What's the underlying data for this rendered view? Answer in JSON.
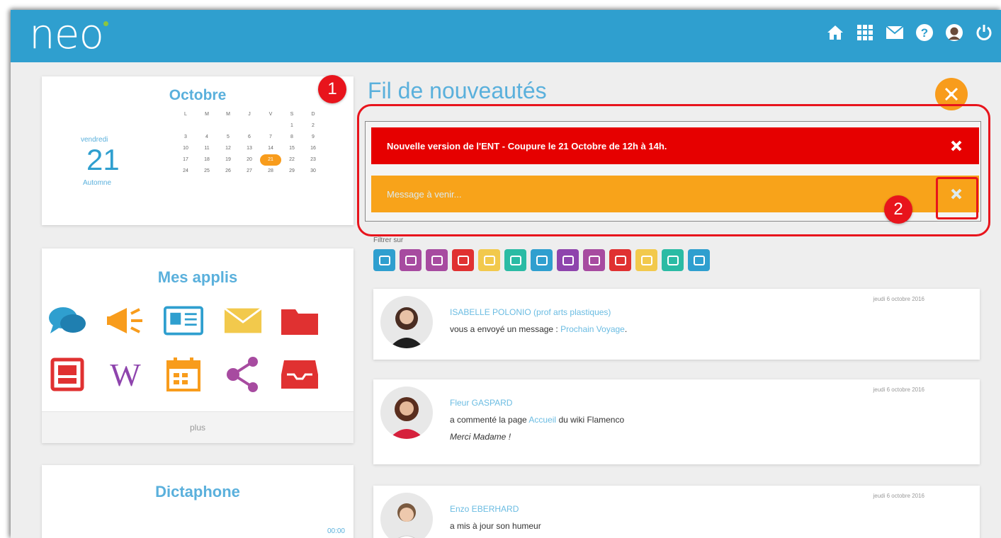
{
  "header": {
    "logo": "neo",
    "icons": [
      "home-icon",
      "apps-grid-icon",
      "mail-icon",
      "help-icon",
      "avatar",
      "power-icon"
    ]
  },
  "calendar": {
    "month": "Octobre",
    "day_name": "vendredi",
    "day_number": "21",
    "season": "Automne",
    "weekdays": [
      "L",
      "M",
      "M",
      "J",
      "V",
      "S",
      "D"
    ],
    "weeks": [
      [
        "",
        "",
        "",
        "",
        "",
        "1",
        "2"
      ],
      [
        "3",
        "4",
        "5",
        "6",
        "7",
        "8",
        "9"
      ],
      [
        "10",
        "11",
        "12",
        "13",
        "14",
        "15",
        "16"
      ],
      [
        "17",
        "18",
        "19",
        "20",
        "21",
        "22",
        "23"
      ],
      [
        "24",
        "25",
        "26",
        "27",
        "28",
        "29",
        "30"
      ]
    ],
    "today": "21"
  },
  "apps": {
    "title": "Mes applis",
    "items": [
      "messagerie-icon",
      "actualites-icon",
      "annuaire-icon",
      "mail-icon",
      "documents-icon",
      "tableau-icon",
      "wiki-icon",
      "calendrier-icon",
      "reseau-icon",
      "casier-icon"
    ],
    "more_label": "plus"
  },
  "dictaphone": {
    "title": "Dictaphone",
    "time": "00:00"
  },
  "feed": {
    "title": "Fil de nouveautés",
    "flash_messages": [
      {
        "text": "Nouvelle version de l'ENT - Coupure le 21 Octobre de 12h à 14h.",
        "color": "#e60000"
      },
      {
        "text": "Message à venir...",
        "color": "#f8a31a"
      }
    ],
    "filter_label": "Filtrer sur",
    "filter_colors": [
      "#2f9fcf",
      "#a74ba0",
      "#a74ba0",
      "#e03131",
      "#f2c94c",
      "#2bbba4",
      "#2f9fcf",
      "#8e44ad",
      "#a74ba0",
      "#e03131",
      "#f2c94c",
      "#2bbba4",
      "#2f9fcf"
    ],
    "posts": [
      {
        "date": "jeudi 6 octobre 2016",
        "user": "ISABELLE POLONIO (prof arts plastiques)",
        "text": "vous a envoyé un message :",
        "link": "Prochain Voyage",
        "suffix": "."
      },
      {
        "date": "jeudi 6 octobre 2016",
        "user": "Fleur GASPARD",
        "text": "a commenté la page",
        "link": "Accueil",
        "suffix": "du wiki Flamenco",
        "quote": "Merci Madame !"
      },
      {
        "date": "jeudi 6 octobre 2016",
        "user": "Enzo EBERHARD",
        "text": "a mis à jour son humeur"
      }
    ]
  },
  "annotations": [
    "1",
    "2"
  ]
}
